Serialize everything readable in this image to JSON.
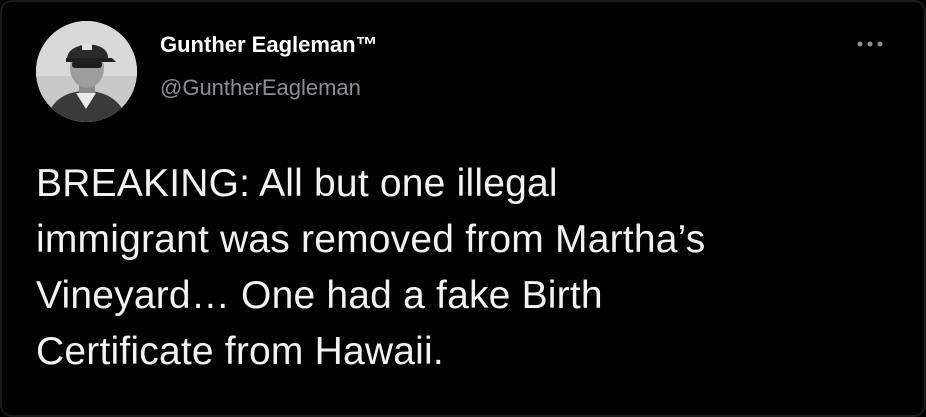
{
  "tweet": {
    "author": {
      "display_name": "Gunther Eagleman™",
      "handle": "@GuntherEagleman",
      "avatar_icon": "user-photo-avatar"
    },
    "more_icon": "more-dots-icon",
    "text_lines": [
      "BREAKING: All but one illegal",
      "immigrant was removed from Martha’s",
      "Vineyard…  One had a fake Birth",
      "Certificate from Hawaii."
    ]
  },
  "colors": {
    "background": "#000000",
    "text": "#e7e9ea",
    "secondary_text": "#8b8f94"
  }
}
